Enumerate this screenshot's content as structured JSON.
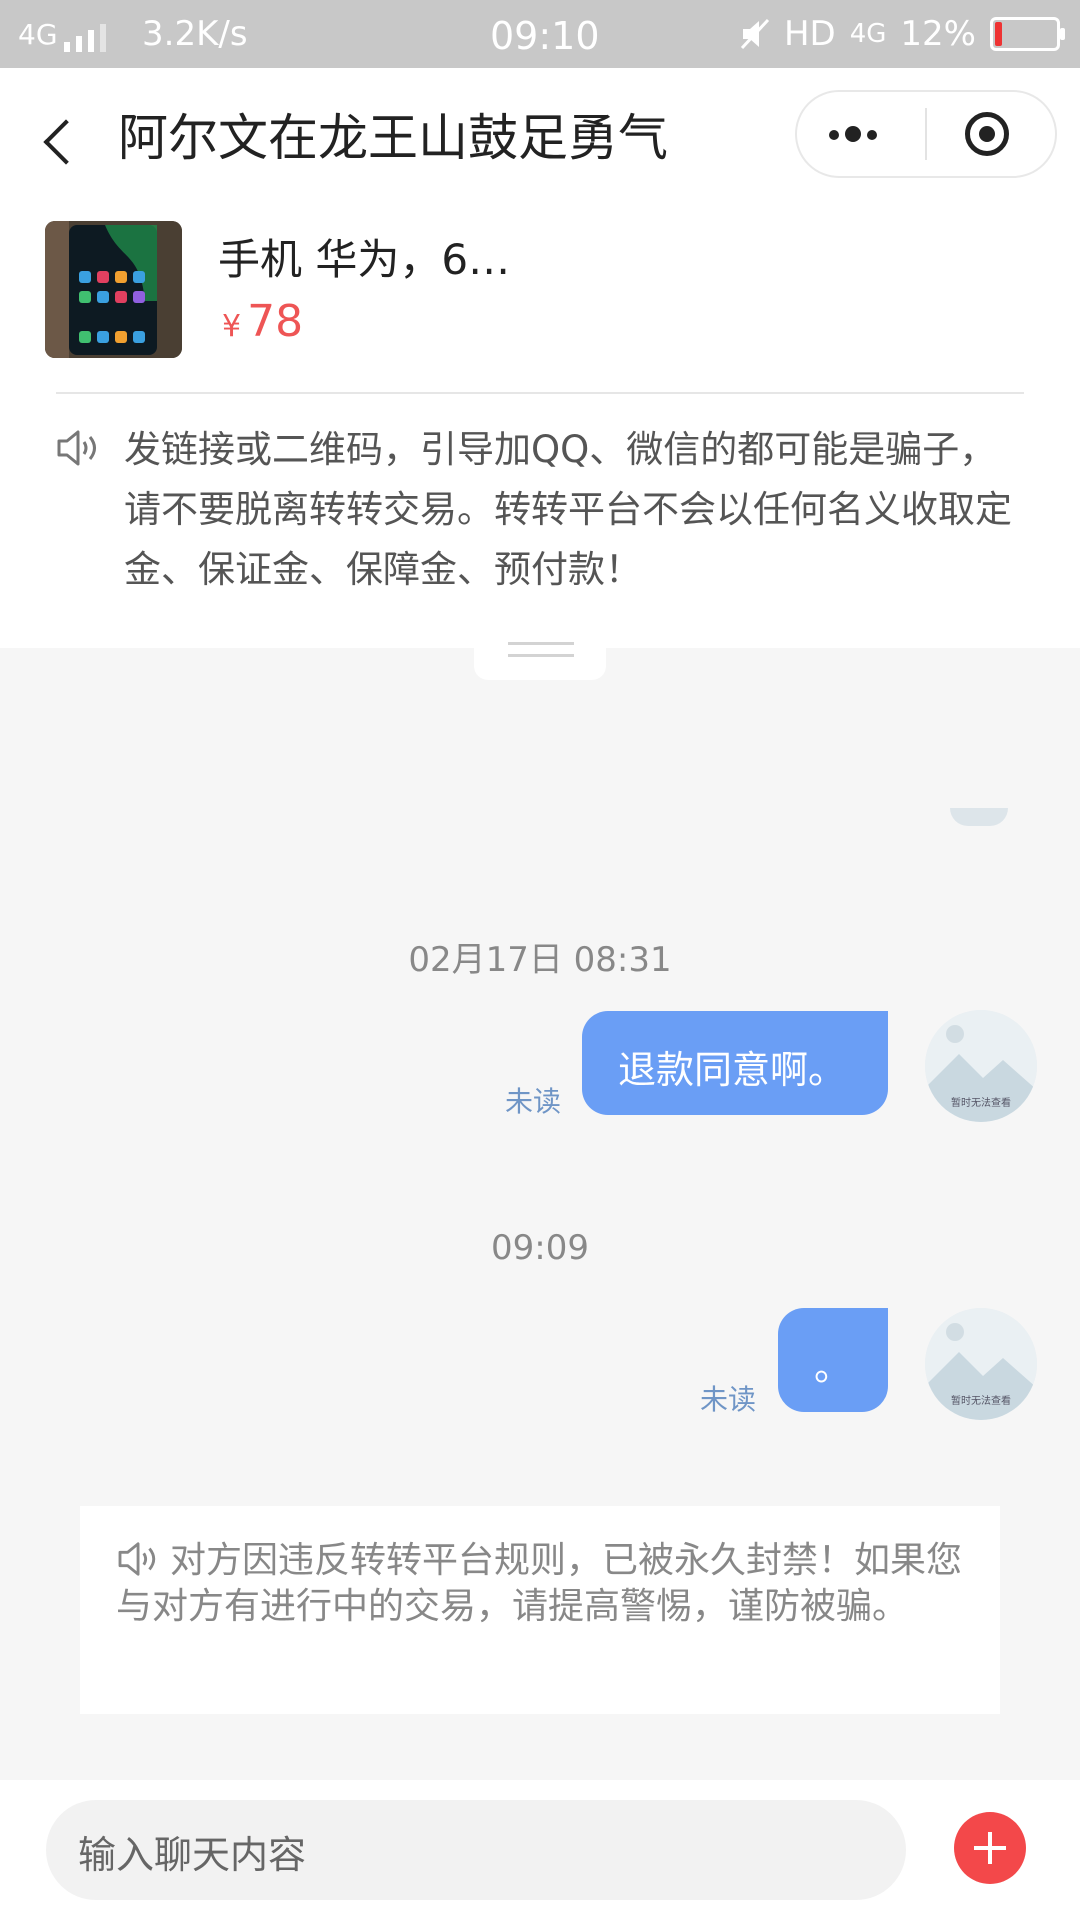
{
  "status_bar": {
    "network": "4G",
    "speed": "3.2K/s",
    "time": "09:10",
    "hd": "HD",
    "net_right": "4G",
    "battery_percent": "12%",
    "battery_level": 0.12
  },
  "header": {
    "title": "阿尔文在龙王山鼓足勇气"
  },
  "product": {
    "name": "手机 华为，6…",
    "currency": "¥",
    "price": "78"
  },
  "warning": {
    "text": "发链接或二维码，引导加QQ、微信的都可能是骗子，请不要脱离转转交易。转转平台不会以任何名义收取定金、保证金、保障金、预付款！"
  },
  "messages": [
    {
      "timestamp": "02月17日 08:31",
      "text": "退款同意啊。",
      "status": "未读",
      "avatar_caption": "暂时无法查看"
    },
    {
      "timestamp": "09:09",
      "text": "。",
      "status": "未读",
      "avatar_caption": "暂时无法查看"
    }
  ],
  "ban_notice": {
    "text": "对方因违反转转平台规则，已被永久封禁！如果您与对方有进行中的交易，请提高警惕，谨防被骗。"
  },
  "input": {
    "placeholder": "输入聊天内容"
  },
  "colors": {
    "status_bar": "#c8c8c8",
    "bubble": "#6a9ef5",
    "price": "#ee5555",
    "plus_button": "#f3484a",
    "unread": "#6f95c6"
  }
}
